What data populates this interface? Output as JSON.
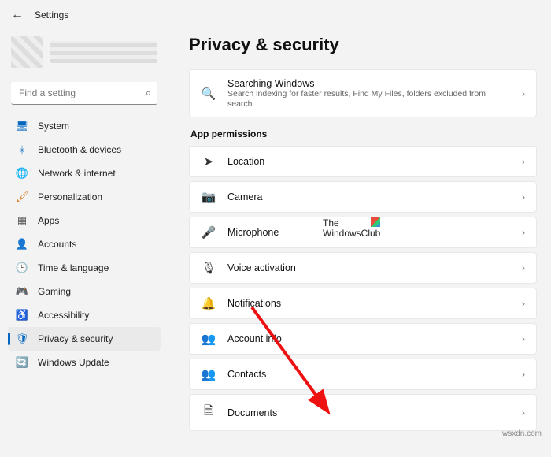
{
  "header": {
    "title": "Settings"
  },
  "search": {
    "placeholder": "Find a setting"
  },
  "nav": {
    "items": [
      {
        "label": "System",
        "color": "#0067c0"
      },
      {
        "label": "Bluetooth & devices",
        "color": "#0067c0"
      },
      {
        "label": "Network & internet",
        "color": "#0067c0"
      },
      {
        "label": "Personalization",
        "color": "#d97b29"
      },
      {
        "label": "Apps",
        "color": "#555"
      },
      {
        "label": "Accounts",
        "color": "#555"
      },
      {
        "label": "Time & language",
        "color": "#555"
      },
      {
        "label": "Gaming",
        "color": "#2e8b57"
      },
      {
        "label": "Accessibility",
        "color": "#0067c0"
      },
      {
        "label": "Privacy & security",
        "color": "#0067c0"
      },
      {
        "label": "Windows Update",
        "color": "#0067c0"
      }
    ],
    "active_index": 9
  },
  "page": {
    "title": "Privacy & security",
    "top_card": {
      "title": "Searching Windows",
      "subtitle": "Search indexing for faster results, Find My Files, folders excluded from search"
    },
    "section_label": "App permissions",
    "perm_items": [
      {
        "label": "Location"
      },
      {
        "label": "Camera"
      },
      {
        "label": "Microphone"
      },
      {
        "label": "Voice activation"
      },
      {
        "label": "Notifications"
      },
      {
        "label": "Account info"
      },
      {
        "label": "Contacts"
      },
      {
        "label": "Documents"
      }
    ]
  },
  "watermark": {
    "line1": "The",
    "line2": "WindowsClub",
    "site": "wsxdn.com"
  }
}
